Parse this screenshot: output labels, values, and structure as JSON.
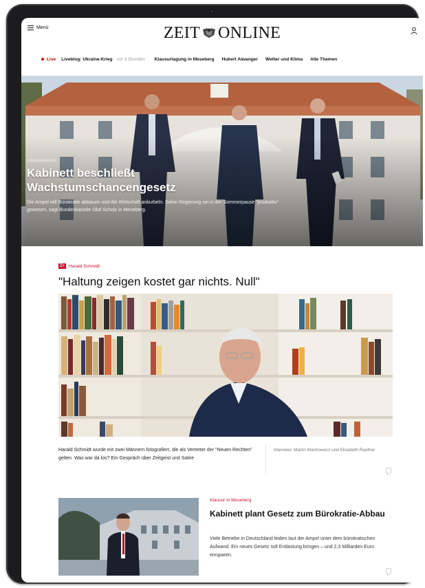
{
  "header": {
    "menu_label": "Menü",
    "logo_left": "ZEIT",
    "logo_right": "ONLINE"
  },
  "nav": {
    "live_label": "Live",
    "liveblog": "Liveblog: Ukraine-Krieg",
    "liveblog_time": "vor 3 Stunden",
    "items": [
      "Klausurtagung in Meseberg",
      "Hubert Aiwanger",
      "Wetter und Klima",
      "Alle Themen"
    ]
  },
  "hero": {
    "kicker": "Ampelkoalition",
    "title": "Kabinett beschließt Wachstumschancengesetz",
    "teaser": "Die Ampel will Bürokratie abbauen und die Wirtschaft ankurbeln. Seine Regierung sei in der Sommerpause \"produktiv\" gewesen, sagt Bundeskanzler Olaf Scholz in Meseberg."
  },
  "article1": {
    "badge": "Z+",
    "kicker": "Harald Schmidt",
    "title": "\"Haltung zeigen kostet gar nichts. Null\"",
    "teaser": "Harald Schmidt wurde mit zwei Männern fotografiert, die als Vertreter der \"Neuen Rechten\" gelten. Was war da los? Ein Gespräch über Zeitgeist und Satire",
    "credit": "Interview: Martin Machowecz und Elisabeth Raether"
  },
  "article2": {
    "kicker": "Klausur in Meseberg",
    "title": "Kabinett plant Gesetz zum Bürokratie-Abbau",
    "teaser": "Viele Betriebe in Deutschland leiden laut der Ampel unter dem bürokratischen Aufwand. Ein neues Gesetz soll Entlastung bringen – und 2,3 Milliarden Euro einsparen."
  },
  "colors": {
    "accent_red": "#c8102e",
    "live_red": "#d40000",
    "device_frame": "#1c1c1e"
  },
  "icons": [
    "hamburger-menu-icon",
    "zeit-crest-icon",
    "user-icon",
    "live-dot-icon",
    "zplus-badge-icon",
    "comment-icon"
  ]
}
